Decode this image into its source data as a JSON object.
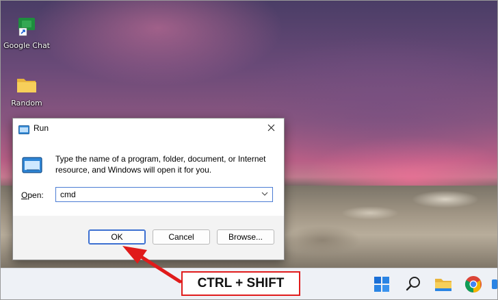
{
  "desktop": {
    "icons": [
      {
        "label": "Google Chat",
        "icon": "google-chat-shortcut-icon"
      },
      {
        "label": "Random",
        "icon": "folder-icon"
      }
    ]
  },
  "run_dialog": {
    "title": "Run",
    "description": "Type the name of a program, folder, document, or Internet resource, and Windows will open it for you.",
    "open_label_accel": "O",
    "open_label_rest": "pen:",
    "open_value": "cmd",
    "buttons": {
      "ok": "OK",
      "cancel": "Cancel",
      "browse": "Browse..."
    }
  },
  "annotation": {
    "shortcut_text": "CTRL + SHIFT",
    "color": "#e01b1b"
  },
  "taskbar": {
    "icons": [
      "windows-start-icon",
      "search-icon",
      "file-explorer-icon",
      "chrome-icon"
    ]
  }
}
